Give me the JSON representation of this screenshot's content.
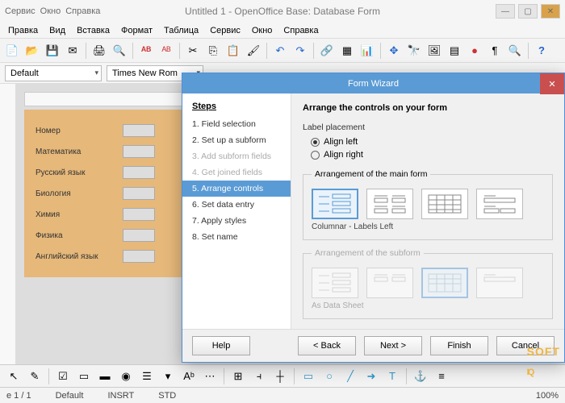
{
  "window": {
    "title": "Untitled 1 - OpenOffice Base: Database Form",
    "top_menus": [
      "Сервис",
      "Окно",
      "Справка"
    ]
  },
  "menubar": [
    "Правка",
    "Вид",
    "Вставка",
    "Формат",
    "Таблица",
    "Сервис",
    "Окно",
    "Справка"
  ],
  "font": {
    "style": "Default",
    "family": "Times New Rom"
  },
  "form_fields": [
    "Номер",
    "Математика",
    "Русский язык",
    "Биология",
    "Химия",
    "Физика",
    "Английский язык"
  ],
  "status": {
    "page": "е 1 / 1",
    "style": "Default",
    "lang": "",
    "insert": "INSRT",
    "std": "STD",
    "zoom": "100%"
  },
  "wizard": {
    "title": "Form Wizard",
    "steps_header": "Steps",
    "steps": [
      {
        "label": "1. Field selection",
        "state": "normal"
      },
      {
        "label": "2. Set up a subform",
        "state": "normal"
      },
      {
        "label": "3. Add subform fields",
        "state": "disabled"
      },
      {
        "label": "4. Get joined fields",
        "state": "disabled"
      },
      {
        "label": "5. Arrange controls",
        "state": "active"
      },
      {
        "label": "6. Set data entry",
        "state": "normal"
      },
      {
        "label": "7. Apply styles",
        "state": "normal"
      },
      {
        "label": "8. Set name",
        "state": "normal"
      }
    ],
    "heading": "Arrange the controls on your form",
    "label_placement": {
      "group": "Label placement",
      "options": [
        {
          "label": "Align left",
          "checked": true
        },
        {
          "label": "Align right",
          "checked": false
        }
      ]
    },
    "main_arrangement": {
      "legend": "Arrangement of the main form",
      "selected_caption": "Columnar - Labels Left",
      "options": [
        "columnar-left",
        "columnar-top",
        "datasheet",
        "blocks-top"
      ]
    },
    "sub_arrangement": {
      "legend": "Arrangement of the subform",
      "selected_caption": "As Data Sheet",
      "options": [
        "columnar-left",
        "columnar-top",
        "datasheet",
        "blocks-top"
      ]
    },
    "buttons": {
      "help": "Help",
      "back": "< Back",
      "next": "Next >",
      "finish": "Finish",
      "cancel": "Cancel"
    }
  },
  "watermark": {
    "brand": "SOFT",
    "sub": "IQ"
  },
  "toolbar_icons": [
    "new",
    "open",
    "save",
    "mail",
    "print",
    "preview",
    "sep",
    "spell",
    "autospell",
    "sep",
    "cut",
    "copy",
    "paste",
    "brush",
    "sep",
    "undo",
    "redo",
    "sep",
    "link",
    "table",
    "chart",
    "sep",
    "nav",
    "find",
    "gallery",
    "datasource",
    "record",
    "para",
    "help"
  ],
  "bottom_icons": [
    "select",
    "design",
    "sep",
    "checkbox",
    "textbox",
    "button",
    "option",
    "list",
    "combo",
    "label",
    "more",
    "sep",
    "grid",
    "snap",
    "guides",
    "sep",
    "shape1",
    "shape2",
    "shape3",
    "shape4",
    "text",
    "sep",
    "anchor",
    "align",
    "arrange"
  ]
}
